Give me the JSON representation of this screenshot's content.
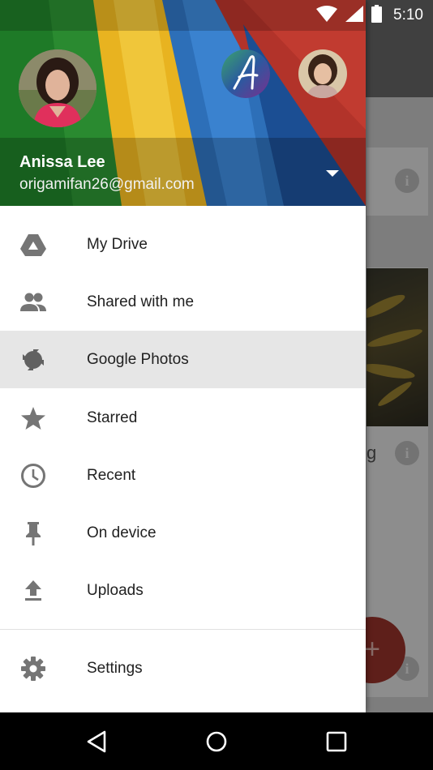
{
  "status_bar": {
    "time": "5:10"
  },
  "account": {
    "name": "Anissa Lee",
    "email": "origamifan26@gmail.com"
  },
  "nav": {
    "items": [
      {
        "label": "My Drive",
        "icon": "drive-icon"
      },
      {
        "label": "Shared with me",
        "icon": "people-icon"
      },
      {
        "label": "Google Photos",
        "icon": "photos-icon",
        "active": true
      },
      {
        "label": "Starred",
        "icon": "star-icon"
      },
      {
        "label": "Recent",
        "icon": "clock-icon"
      },
      {
        "label": "On device",
        "icon": "pin-icon"
      },
      {
        "label": "Uploads",
        "icon": "upload-icon"
      }
    ],
    "settings_label": "Settings"
  },
  "background_app": {
    "partial_text": "g",
    "fab_symbol": "+"
  },
  "colors": {
    "active_row": "#e6e6e6",
    "icon": "#757575",
    "fab": "#a3362e"
  }
}
